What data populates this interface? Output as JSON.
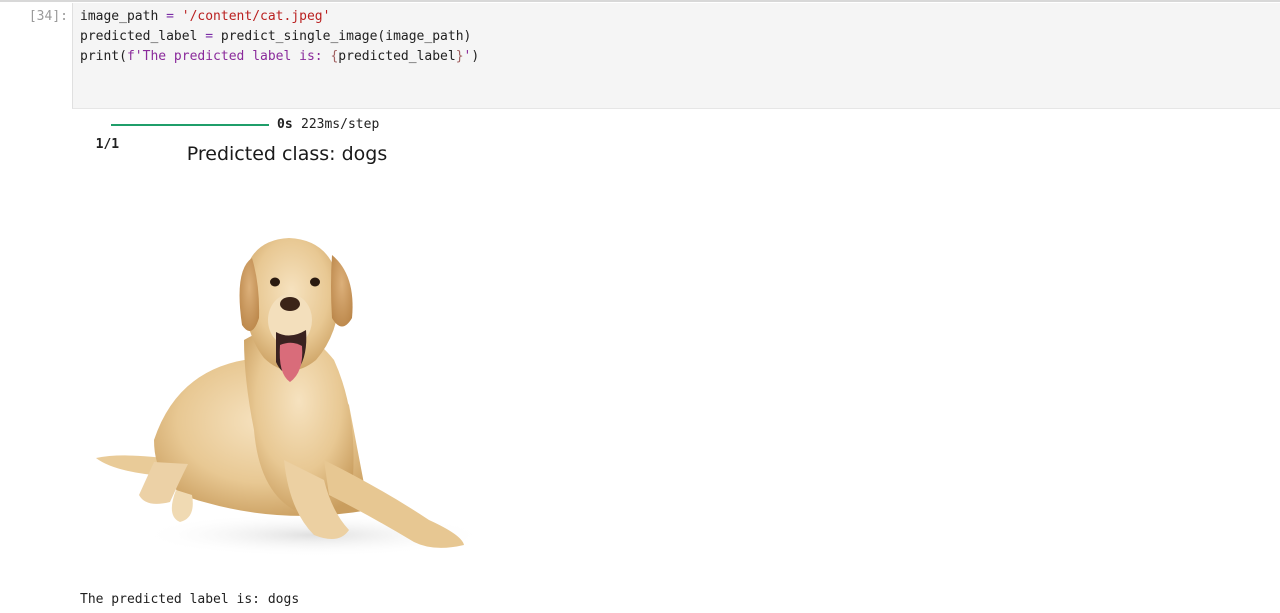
{
  "cell": {
    "prompt": "[34]:",
    "code": {
      "line1": {
        "a": "image_path ",
        "op": "=",
        "b": " ",
        "str": "'/content/cat.jpeg'"
      },
      "line2": {
        "a": "predicted_label ",
        "op": "=",
        "b": " predict_single_image(image_path)"
      },
      "line3": {
        "a": "print(",
        "fstr1": "f'The predicted label is: ",
        "brace_open": "{",
        "var": "predicted_label",
        "brace_close": "}",
        "fstr2": "'",
        "c": ")"
      }
    }
  },
  "output": {
    "progress": {
      "counter": "1/1",
      "fraction": 1.0,
      "eta": "0s",
      "step": "223ms/step"
    },
    "figure": {
      "title": "Predicted class: dogs",
      "image_subject": "golden-retriever-dog"
    },
    "result": "The predicted label is: dogs"
  }
}
